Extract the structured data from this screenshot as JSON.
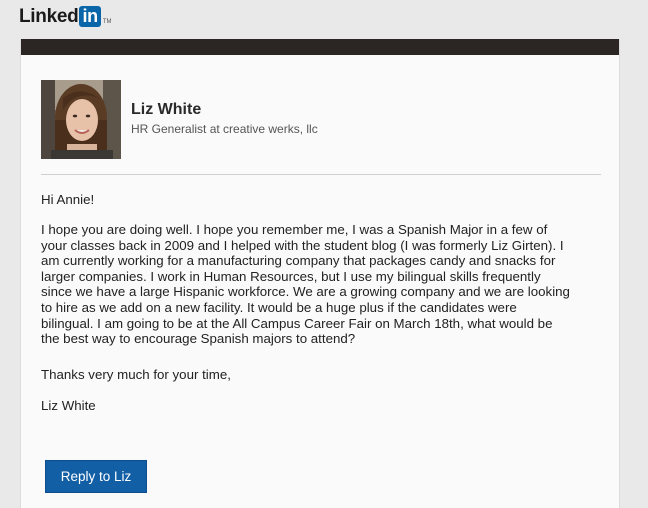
{
  "logo": {
    "word": "Linked",
    "badge": "in",
    "trademark": "TM"
  },
  "sender": {
    "name": "Liz White",
    "title": "HR Generalist at creative werks, llc"
  },
  "message": {
    "greeting": "Hi Annie!",
    "body_lines": [
      "I hope you are doing well. I hope you remember me, I was a Spanish Major in a few of",
      "your classes back in 2009 and I helped with the student blog (I was formerly Liz Girten). I",
      "am currently working for a manufacturing company that packages candy and snacks for",
      "larger companies. I work in Human Resources, but I use my bilingual skills frequently",
      "since we have a large Hispanic workforce. We are a growing company and we are looking",
      "to hire as we add on a new facility. It would be a huge plus if the candidates were",
      "bilingual. I am going to be at the All Campus Career Fair on March 18th, what would be",
      "the best way to encourage Spanish majors to attend?"
    ],
    "thanks": "Thanks very much for your time,",
    "signoff": "Liz White"
  },
  "actions": {
    "reply_label": "Reply to Liz"
  },
  "colors": {
    "topbar": "#2b2623",
    "button": "#125fa6",
    "logo_badge": "#0a66a8"
  }
}
